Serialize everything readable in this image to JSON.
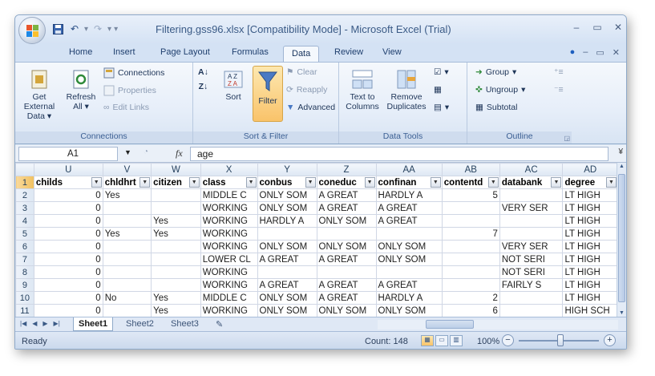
{
  "window": {
    "title": "Filtering.gss96.xlsx  [Compatibility Mode] - Microsoft Excel (Trial)",
    "controls": [
      "minimize-icon",
      "restore-icon",
      "close-icon"
    ]
  },
  "tabs": [
    "Home",
    "Insert",
    "Page Layout",
    "Formulas",
    "Data",
    "Review",
    "View"
  ],
  "active_tab": "Data",
  "ribbon": {
    "connections": {
      "label": "Connections",
      "get_external": "Get External",
      "get_external_2": "Data",
      "refresh": "Refresh",
      "refresh_2": "All",
      "connections_btn": "Connections",
      "properties": "Properties",
      "edit_links": "Edit Links"
    },
    "sortfilter": {
      "label": "Sort & Filter",
      "sort": "Sort",
      "filter": "Filter",
      "clear": "Clear",
      "reapply": "Reapply",
      "advanced": "Advanced"
    },
    "datatools": {
      "label": "Data Tools",
      "text_to": "Text to",
      "columns": "Columns",
      "remove": "Remove",
      "duplicates": "Duplicates"
    },
    "outline": {
      "label": "Outline",
      "group": "Group",
      "ungroup": "Ungroup",
      "subtotal": "Subtotal"
    }
  },
  "formula_bar": {
    "name_box": "A1",
    "fx": "fx",
    "value": "age"
  },
  "sheet": {
    "columns": [
      "U",
      "V",
      "W",
      "X",
      "Y",
      "Z",
      "AA",
      "AB",
      "AC",
      "AD"
    ],
    "header_row": [
      "childs",
      "chldhrt",
      "citizen",
      "class",
      "conbus",
      "coneduc",
      "confinan",
      "contentd",
      "databank",
      "degree"
    ],
    "rows": [
      {
        "num": "2",
        "cells": [
          "0",
          "Yes",
          "",
          "MIDDLE C",
          "ONLY SOM",
          "A GREAT",
          "HARDLY A",
          "5",
          "",
          "LT HIGH"
        ]
      },
      {
        "num": "3",
        "cells": [
          "0",
          "",
          "",
          "WORKING",
          "ONLY SOM",
          "A GREAT",
          "A GREAT",
          "",
          "VERY SER",
          "LT HIGH"
        ]
      },
      {
        "num": "4",
        "cells": [
          "0",
          "",
          "Yes",
          "WORKING",
          "HARDLY A",
          "ONLY SOM",
          "A GREAT",
          "",
          "",
          "LT HIGH"
        ]
      },
      {
        "num": "5",
        "cells": [
          "0",
          "Yes",
          "Yes",
          "WORKING",
          "",
          "",
          "",
          "7",
          "",
          "LT HIGH"
        ]
      },
      {
        "num": "6",
        "cells": [
          "0",
          "",
          "",
          "WORKING",
          "ONLY SOM",
          "ONLY SOM",
          "ONLY SOM",
          "",
          "VERY SER",
          "LT HIGH"
        ]
      },
      {
        "num": "7",
        "cells": [
          "0",
          "",
          "",
          "LOWER CL",
          "A GREAT",
          "A GREAT",
          "ONLY SOM",
          "",
          "NOT SERI",
          "LT HIGH"
        ]
      },
      {
        "num": "8",
        "cells": [
          "0",
          "",
          "",
          "WORKING",
          "",
          "",
          "",
          "",
          "NOT SERI",
          "LT HIGH"
        ]
      },
      {
        "num": "9",
        "cells": [
          "0",
          "",
          "",
          "WORKING",
          "A GREAT",
          "A GREAT",
          "A GREAT",
          "",
          "FAIRLY S",
          "LT HIGH"
        ]
      },
      {
        "num": "10",
        "cells": [
          "0",
          "No",
          "Yes",
          "MIDDLE C",
          "ONLY SOM",
          "A GREAT",
          "HARDLY A",
          "2",
          "",
          "LT HIGH"
        ]
      },
      {
        "num": "11",
        "cells": [
          "0",
          "",
          "Yes",
          "WORKING",
          "ONLY SOM",
          "ONLY SOM",
          "ONLY SOM",
          "6",
          "",
          "HIGH SCH"
        ]
      }
    ]
  },
  "sheet_tabs": [
    "Sheet1",
    "Sheet2",
    "Sheet3"
  ],
  "active_sheet": "Sheet1",
  "status": {
    "mode": "Ready",
    "count": "Count: 148",
    "zoom": "100%"
  }
}
